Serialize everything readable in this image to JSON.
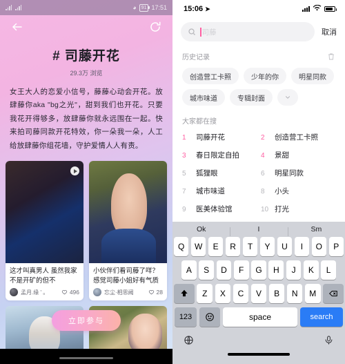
{
  "left": {
    "status": {
      "time": "17:51",
      "battery": "91"
    },
    "nav": {
      "back_icon": "back-arrow-icon",
      "share_icon": "share-icon"
    },
    "title": "# 司藤开花",
    "views": "29.3万 浏览",
    "description": "女王大人的恋爱小信号，藤藤心动会开花。放肆藤你aka \"bg之光\"，甜到我们也开花。只要我花开得够多，放肆藤你就永远围在一起。快来拍司藤同款开花特效，你一朵我一朵，人工给放肆藤你组花墙，守护爱情人人有责。",
    "cards": [
      {
        "text": "这才叫真男人\n虽然我家不是开矿的但不",
        "user": "孟月.缘 ' 。",
        "likes": "496",
        "has_play": true
      },
      {
        "text": "小伙伴们看司藤了咩？感觉司藤小姐好有气质啊，",
        "user": "忘尘·相思阙",
        "likes": "28",
        "has_play": false
      }
    ],
    "cta": "立即参与"
  },
  "right": {
    "status": {
      "time": "15:06"
    },
    "search": {
      "placeholder": "司藤",
      "cancel": "取消",
      "icon": "search-icon"
    },
    "history": {
      "title": "历史记录",
      "delete_icon": "trash-icon",
      "tags": [
        "创造营工卡照",
        "少年的你",
        "明星同款",
        "城市味道",
        "专辑封面"
      ],
      "more_icon": "chevron-down-icon"
    },
    "hot": {
      "title": "大家都在搜",
      "items": [
        {
          "rank": "1",
          "word": "司藤开花",
          "highlight": true
        },
        {
          "rank": "2",
          "word": "创造营工卡照",
          "highlight": true
        },
        {
          "rank": "3",
          "word": "春日限定自拍",
          "highlight": true
        },
        {
          "rank": "4",
          "word": "景甜",
          "highlight": true
        },
        {
          "rank": "5",
          "word": "狐狸眼",
          "highlight": false
        },
        {
          "rank": "6",
          "word": "明星同款",
          "highlight": false
        },
        {
          "rank": "7",
          "word": "城市味道",
          "highlight": false
        },
        {
          "rank": "8",
          "word": "小头",
          "highlight": false
        },
        {
          "rank": "9",
          "word": "医美体验馆",
          "highlight": false
        },
        {
          "rank": "10",
          "word": "打光",
          "highlight": false
        }
      ]
    },
    "keyboard": {
      "suggestions": [
        "Ok",
        "I",
        "Sm"
      ],
      "row1": [
        "Q",
        "W",
        "E",
        "R",
        "T",
        "Y",
        "U",
        "I",
        "O",
        "P"
      ],
      "row2": [
        "A",
        "S",
        "D",
        "F",
        "G",
        "H",
        "J",
        "K",
        "L"
      ],
      "row3": [
        "Z",
        "X",
        "C",
        "V",
        "B",
        "N",
        "M"
      ],
      "shift_icon": "shift-icon",
      "backspace_icon": "backspace-icon",
      "num_label": "123",
      "emoji_icon": "emoji-icon",
      "space_label": "space",
      "search_label": "search",
      "globe_icon": "globe-icon",
      "mic_icon": "microphone-icon"
    }
  },
  "colors": {
    "accent_pink": "#ff5fa2",
    "key_blue": "#2a7cf6"
  }
}
